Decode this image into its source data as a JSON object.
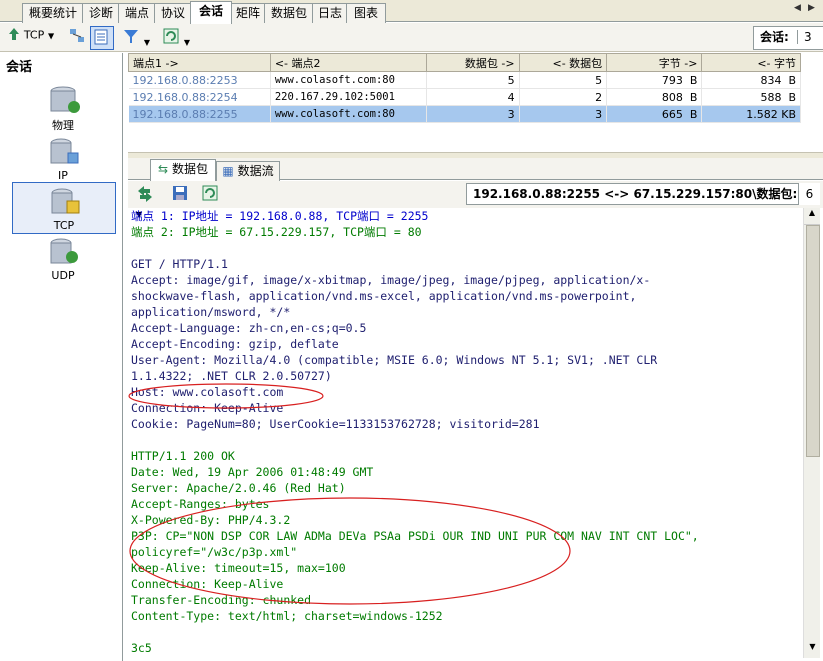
{
  "tabs": [
    "概要统计",
    "诊断",
    "端点",
    "协议",
    "会话",
    "矩阵",
    "数据包",
    "日志",
    "图表"
  ],
  "active_tab": "会话",
  "toolbar": {
    "protocol_filter": "TCP",
    "session_label": "会话:",
    "session_count": "3"
  },
  "left_panel": {
    "title": "会话",
    "items": [
      "物理",
      "IP",
      "TCP",
      "UDP"
    ],
    "selected": "TCP"
  },
  "table": {
    "headers": [
      "端点1 ->",
      "<- 端点2",
      "数据包 ->",
      "<- 数据包",
      "字节 ->",
      "<- 字节"
    ],
    "rows": [
      [
        "192.168.0.88:2253",
        "www.colasoft.com:80",
        "5",
        "5",
        "793  B",
        "834  B"
      ],
      [
        "192.168.0.88:2254",
        "220.167.29.102:5001",
        "4",
        "2",
        "808  B",
        "588  B"
      ],
      [
        "192.168.0.88:2255",
        "www.colasoft.com:80",
        "3",
        "3",
        "665  B",
        "1.582 KB"
      ]
    ],
    "selected_row": 2
  },
  "subtabs": [
    "数据包",
    "数据流"
  ],
  "stream": {
    "endpoints": "192.168.0.88:2255 <-> 67.15.229.157:80\\数据包:",
    "packet_count": "6"
  },
  "content_lines": [
    {
      "t": "端点 1: IP地址 = 192.168.0.88, TCP端口 = 2255",
      "c": "blue"
    },
    {
      "t": "端点 2: IP地址 = 67.15.229.157, TCP端口 = 80",
      "c": "green"
    },
    {
      "t": "",
      "c": "dark"
    },
    {
      "t": "GET / HTTP/1.1",
      "c": "dark"
    },
    {
      "t": "Accept: image/gif, image/x-xbitmap, image/jpeg, image/pjpeg, application/x-",
      "c": "dark"
    },
    {
      "t": "shockwave-flash, application/vnd.ms-excel, application/vnd.ms-powerpoint,",
      "c": "dark"
    },
    {
      "t": "application/msword, */*",
      "c": "dark"
    },
    {
      "t": "Accept-Language: zh-cn,en-cs;q=0.5",
      "c": "dark"
    },
    {
      "t": "Accept-Encoding: gzip, deflate",
      "c": "dark"
    },
    {
      "t": "User-Agent: Mozilla/4.0 (compatible; MSIE 6.0; Windows NT 5.1; SV1; .NET CLR",
      "c": "dark"
    },
    {
      "t": "1.1.4322; .NET CLR 2.0.50727)",
      "c": "dark"
    },
    {
      "t": "Host: www.colasoft.com",
      "c": "dark"
    },
    {
      "t": "Connection: Keep-Alive",
      "c": "dark"
    },
    {
      "t": "Cookie: PageNum=80; UserCookie=1133153762728; visitorid=281",
      "c": "dark"
    },
    {
      "t": "",
      "c": "dark"
    },
    {
      "t": "HTTP/1.1 200 OK",
      "c": "green"
    },
    {
      "t": "Date: Wed, 19 Apr 2006 01:48:49 GMT",
      "c": "green"
    },
    {
      "t": "Server: Apache/2.0.46 (Red Hat)",
      "c": "green"
    },
    {
      "t": "Accept-Ranges: bytes",
      "c": "green"
    },
    {
      "t": "X-Powered-By: PHP/4.3.2",
      "c": "green"
    },
    {
      "t": "P3P: CP=\"NON DSP COR LAW ADMa DEVa PSAa PSDi OUR IND UNI PUR COM NAV INT CNT LOC\",",
      "c": "green"
    },
    {
      "t": "policyref=\"/w3c/p3p.xml\"",
      "c": "green"
    },
    {
      "t": "Keep-Alive: timeout=15, max=100",
      "c": "green"
    },
    {
      "t": "Connection: Keep-Alive",
      "c": "green"
    },
    {
      "t": "Transfer-Encoding: chunked",
      "c": "green"
    },
    {
      "t": "Content-Type: text/html; charset=windows-1252",
      "c": "green"
    },
    {
      "t": "",
      "c": "green"
    },
    {
      "t": "3c5",
      "c": "green"
    }
  ],
  "colors": {
    "annotation": "#d82020",
    "selection": "#a6c8ee"
  }
}
